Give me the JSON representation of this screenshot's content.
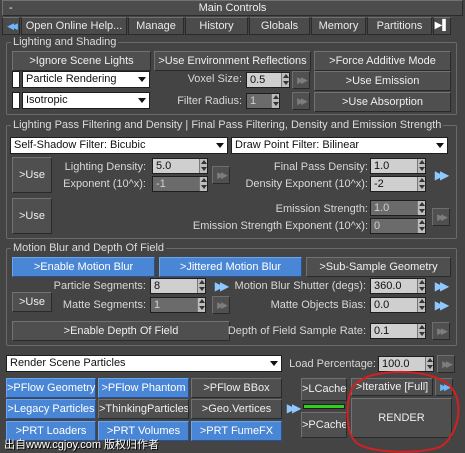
{
  "header": {
    "title": "Main Controls",
    "minus": "-"
  },
  "tabs": [
    {
      "label": "Open Online Help..."
    },
    {
      "label": "Manage"
    },
    {
      "label": "History"
    },
    {
      "label": "Globals"
    },
    {
      "label": "Memory"
    },
    {
      "label": "Partitions"
    }
  ],
  "lighting": {
    "title": "Lighting and Shading",
    "ignore_lights": ">Ignore Scene Lights",
    "use_env_reflections": ">Use Environment Reflections",
    "force_additive": ">Force Additive Mode",
    "rendering_mode": "Particle Rendering",
    "phase_function": "Isotropic",
    "voxel_size_label": "Voxel Size:",
    "voxel_size": "0.5",
    "filter_radius_label": "Filter Radius:",
    "filter_radius": "1",
    "use_emission": ">Use Emission",
    "use_absorption": ">Use Absorption"
  },
  "pass_filtering": {
    "title": "Lighting Pass Filtering and Density | Final Pass Filtering, Density and Emission Strength",
    "self_shadow_filter": "Self-Shadow Filter: Bicubic",
    "draw_point_filter": "Draw Point Filter: Bilinear",
    "use_btn": ">Use",
    "lighting_density_label": "Lighting Density:",
    "lighting_density": "5.0",
    "exponent_label": "Exponent (10^x):",
    "exponent": "-1",
    "final_pass_density_label": "Final Pass Density:",
    "final_pass_density": "1.0",
    "density_exponent_label": "Density Exponent (10^x):",
    "density_exponent": "-2",
    "use_btn2": ">Use",
    "emission_strength_label": "Emission Strength:",
    "emission_strength": "1.0",
    "emission_strength_exp_label": "Emission Strength Exponent (10^x):",
    "emission_strength_exp": "0"
  },
  "motion_blur": {
    "title": "Motion Blur and Depth Of Field",
    "enable_motion_blur": ">Enable Motion Blur",
    "jittered_motion_blur": ">Jittered Motion Blur",
    "sub_sample_geometry": ">Sub-Sample Geometry",
    "particle_segments_label": "Particle Segments:",
    "particle_segments": "8",
    "shutter_label": "Motion Blur Shutter (degs):",
    "shutter": "360.0",
    "use_btn": ">Use",
    "matte_segments_label": "Matte Segments:",
    "matte_segments": "1",
    "matte_bias_label": "Matte Objects Bias:",
    "matte_bias": "0.0",
    "enable_dof": ">Enable Depth Of Field",
    "dof_rate_label": "Depth of Field Sample Rate:",
    "dof_rate": "0.1"
  },
  "bottom": {
    "render_source": "Render Scene Particles",
    "load_percentage_label": "Load Percentage:",
    "load_percentage": "100.0",
    "pflow_geometry": ">PFlow Geometry",
    "pflow_phantom": ">PFlow Phantom",
    "pflow_bbox": ">PFlow BBox",
    "legacy_particles": ">Legacy Particles",
    "thinking_particles": ">ThinkingParticles",
    "geo_vertices": ">Geo.Vertices",
    "prt_loaders": ">PRT Loaders",
    "prt_volumes": ">PRT Volumes",
    "prt_fumefx": ">PRT FumeFX",
    "lcache": ">LCache",
    "pcache": ">PCache",
    "iterative": ">Iterative [Full]",
    "render": "RENDER",
    "watermark": "出自www.cgjoy.com 版权归作者"
  },
  "colors": {
    "accent_blue": "#4a86d6",
    "annotation_red": "#d42020",
    "cache_green": "#2fd020",
    "panel_bg": "#444444"
  }
}
